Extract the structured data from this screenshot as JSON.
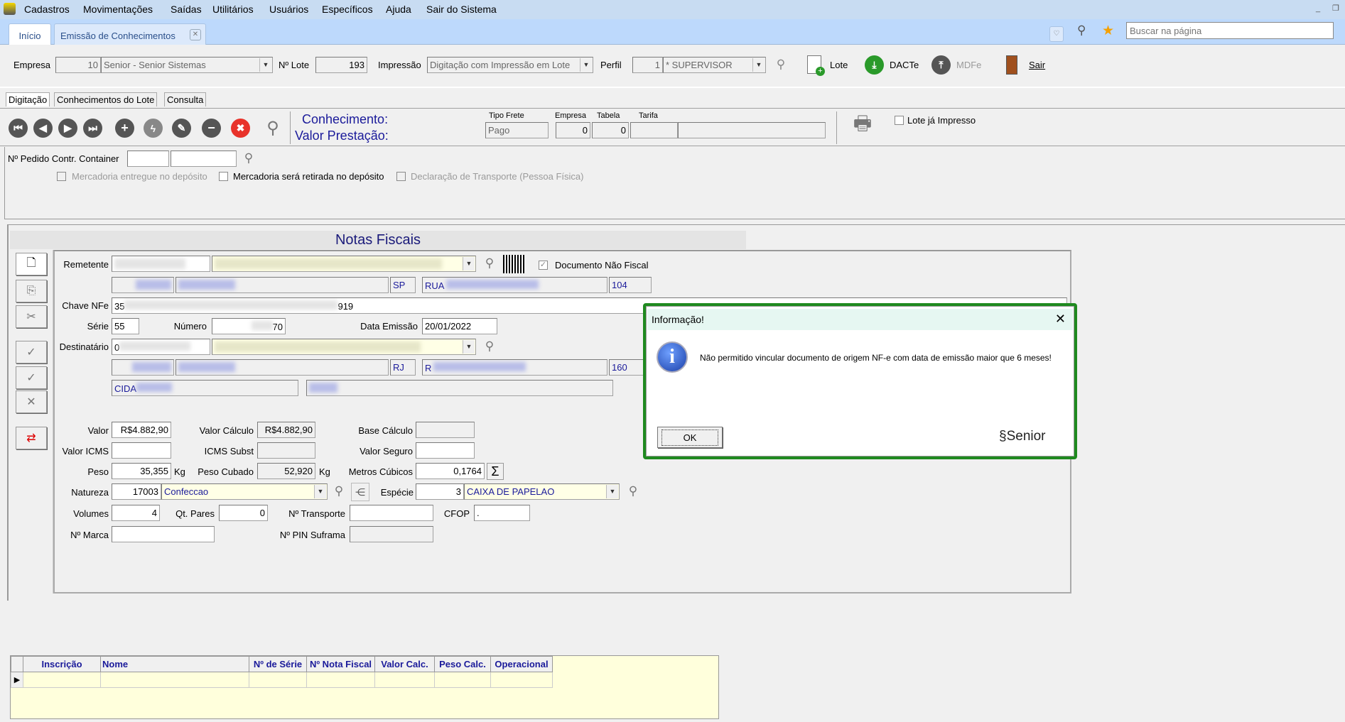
{
  "menu": [
    "Cadastros",
    "Movimentações",
    "Saídas",
    "Utilitários",
    "Usuários",
    "Específicos",
    "Ajuda",
    "Sair do Sistema"
  ],
  "tabs": {
    "home": "Início",
    "current": "Emissão de Conhecimentos"
  },
  "search": {
    "placeholder": "Buscar na página"
  },
  "top": {
    "empresa_label": "Empresa",
    "empresa_code": "10",
    "empresa_name": "Senior - Senior Sistemas",
    "lote_label": "Nº Lote",
    "lote": "193",
    "impressao_label": "Impressão",
    "impressao": "Digitação com Impressão em Lote",
    "perfil_label": "Perfil",
    "perfil_code": "1",
    "perfil": "* SUPERVISOR",
    "btn_lote": "Lote",
    "btn_dacte": "DACTe",
    "btn_mdfe": "MDFe",
    "btn_sair": "Sair"
  },
  "subtabs": [
    "Digitação",
    "Conhecimentos do Lote",
    "Consulta"
  ],
  "toolbar": {
    "conhecimento": "Conhecimento:",
    "valor_prestacao": "Valor Prestação:",
    "tipo_frete_label": "Tipo Frete",
    "tipo_frete": "Pago",
    "empresa_label": "Empresa",
    "empresa": "0",
    "tabela_label": "Tabela",
    "tabela": "0",
    "tarifa_label": "Tarifa",
    "lote_impresso": "Lote já Impresso"
  },
  "pedido": {
    "label": "Nº Pedido Contr. Container",
    "cb1": "Mercadoria entregue no depósito",
    "cb2": "Mercadoria será retirada no depósito",
    "cb3": "Declaração de Transporte (Pessoa Física)"
  },
  "nf": {
    "title": "Notas Fiscais",
    "remetente": "Remetente",
    "doc_nao_fiscal": "Documento Não Fiscal",
    "rem_uf": "SP",
    "rem_rua": "RUA",
    "rem_num": "104",
    "chave_label": "Chave NFe",
    "chave_start": "35",
    "chave_end": "919",
    "serie_label": "Série",
    "serie": "55",
    "numero_label": "Número",
    "numero_end": "70",
    "data_label": "Data Emissão",
    "data": "20/01/2022",
    "destinatario": "Destinatário",
    "dest_code_start": "0",
    "dest_uf": "RJ",
    "dest_rua": "R",
    "dest_num": "160",
    "cidade": "CIDA",
    "valor_label": "Valor",
    "valor": "R$4.882,90",
    "valor_calc_label": "Valor Cálculo",
    "valor_calc": "R$4.882,90",
    "base_label": "Base Cálculo",
    "icms_label": "Valor ICMS",
    "icms_subst_label": "ICMS Subst",
    "seguro_label": "Valor Seguro",
    "peso_label": "Peso",
    "peso": "35,355",
    "kg": "Kg",
    "peso_cub_label": "Peso Cubado",
    "peso_cub": "52,920",
    "m3_label": "Metros Cúbicos",
    "m3": "0,1764",
    "natureza_label": "Natureza",
    "natureza_code": "17003",
    "natureza": "Confeccao",
    "especie_label": "Espécie",
    "especie_code": "3",
    "especie": "CAIXA DE PAPELAO",
    "volumes_label": "Volumes",
    "volumes": "4",
    "pares_label": "Qt. Pares",
    "pares": "0",
    "transporte_label": "Nº Transporte",
    "cfop_label": "CFOP",
    "cfop": ".",
    "marca_label": "Nº Marca",
    "suframa_label": "Nº PIN Suframa"
  },
  "grid": {
    "columns": [
      "Inscrição",
      "Nome",
      "Nº de Série",
      "Nº Nota Fiscal",
      "Valor Calc.",
      "Peso Calc.",
      "Operacional"
    ]
  },
  "dialog": {
    "title": "Informação!",
    "message": "Não permitido vincular documento de origem NF-e com data de emissão maior que 6 meses!",
    "ok": "OK",
    "brand": "Senior"
  },
  "colors": {
    "accent": "#1a1a9a",
    "dialog_border": "#1f8a1f"
  }
}
